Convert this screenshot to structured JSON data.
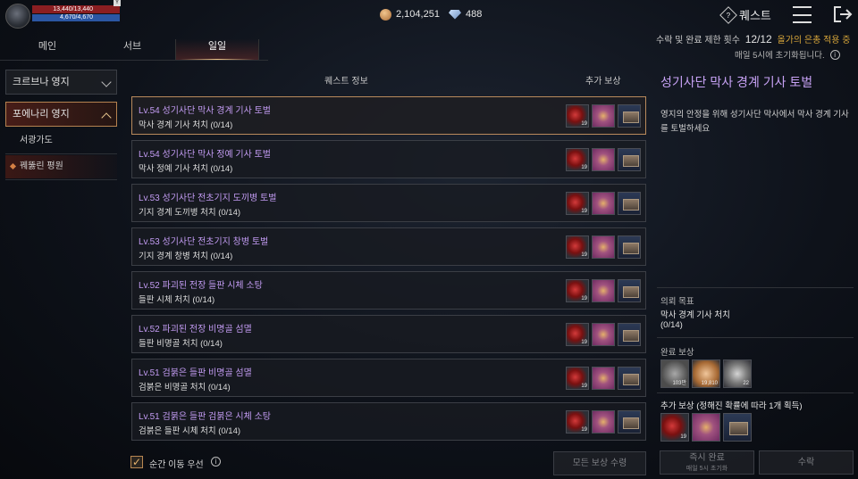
{
  "player": {
    "hp": "13,440/13,440",
    "mp": "4,670/4,670",
    "badge": "Y"
  },
  "currency": {
    "gold": "2,104,251",
    "gems": "488"
  },
  "header": {
    "quest_label": "퀘스트",
    "limit_prefix": "수락 및 완료 제한 횟수",
    "limit_value": "12/12",
    "limit_bonus": "올가의 은총 적용 중",
    "reset_text": "매일 5시에 초기화됩니다."
  },
  "tabs": [
    {
      "label": "메인"
    },
    {
      "label": "서브"
    },
    {
      "label": "일일"
    }
  ],
  "sidebar": {
    "regions": [
      {
        "label": "크르브나 영지"
      },
      {
        "label": "포에나리 영지"
      }
    ],
    "subitems": [
      {
        "label": "서광가도"
      },
      {
        "label": "꿰뚫린 평원"
      }
    ]
  },
  "list_header": {
    "info": "퀘스트 정보",
    "reward": "추가 보상"
  },
  "quests": [
    {
      "title": "Lv.54 성기사단 막사 경계 기사 토벌",
      "desc": "막사 경계 기사 처치 (0/14)",
      "red_count": "19"
    },
    {
      "title": "Lv.54 성기사단 막사 정예 기사 토벌",
      "desc": "막사 정예 기사 처치 (0/14)",
      "red_count": "19"
    },
    {
      "title": "Lv.53 성기사단 전초기지 도끼병 토벌",
      "desc": "기지 경계 도끼병 처치 (0/14)",
      "red_count": "19"
    },
    {
      "title": "Lv.53 성기사단 전초기지 창병 토벌",
      "desc": "기지 경계 창병 처치 (0/14)",
      "red_count": "19"
    },
    {
      "title": "Lv.52 파괴된 전장 들판 시체 소탕",
      "desc": "들판 시체 처치 (0/14)",
      "red_count": "19"
    },
    {
      "title": "Lv.52 파괴된 전장 비명골 섬멸",
      "desc": "들판 비명골 처치 (0/14)",
      "red_count": "19"
    },
    {
      "title": "Lv.51 검붉은 들판 비명골 섬멸",
      "desc": "검붉은 비명골 처치 (0/14)",
      "red_count": "19"
    },
    {
      "title": "Lv.51 검붉은 들판 검붉은 시체 소탕",
      "desc": "검붉은 들판 시체 처치 (0/14)",
      "red_count": "19"
    }
  ],
  "bottom": {
    "teleport_label": "순간 이동 우선",
    "claim_all": "모든 보상 수령",
    "instant_complete": "즉시 완료",
    "instant_sub": "매일 5시 초기화",
    "accept": "수락"
  },
  "detail": {
    "title": "성기사단 막사 경계 기사 토벌",
    "description": "영지의 안정을 위해 성기사단 막사에서 막사 경계 기사를 토벌하세요",
    "objective_label": "의뢰 목표",
    "objective_text": "막사 경계 기사 처치",
    "objective_progress": "(0/14)",
    "complete_reward_label": "완료 보상",
    "complete_rewards": [
      {
        "icon": "exp-icon",
        "count": "103만"
      },
      {
        "icon": "gold-coin-icon",
        "count": "19,810"
      },
      {
        "icon": "silver-coin-icon",
        "count": "22"
      }
    ],
    "extra_reward_label": "추가 보상 (정해진 확률에 따라 1개 획득)",
    "extra_reward_count": "19"
  }
}
